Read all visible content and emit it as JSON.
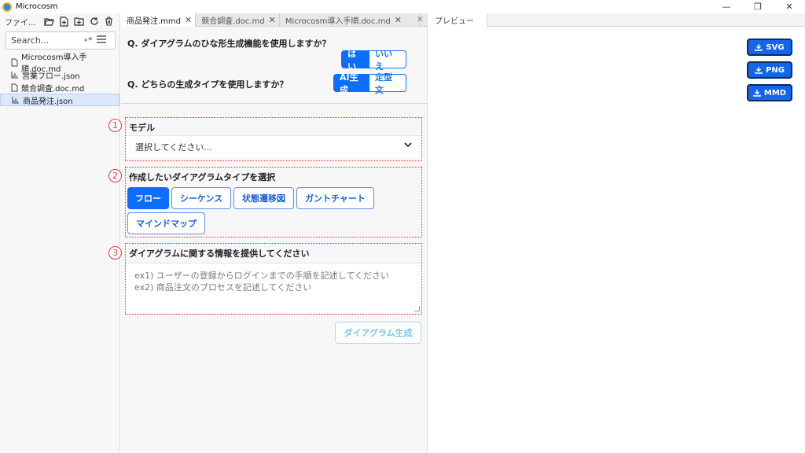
{
  "app": {
    "title": "Microcosm"
  },
  "window": {
    "minimize": "—",
    "restore": "❐",
    "close": "✕"
  },
  "sidebar": {
    "title": "ファイ...",
    "search_placeholder": "Search...",
    "regex_label": "∘*",
    "files": [
      {
        "name": "Microcosm導入手順.doc.md",
        "icon": "document-icon"
      },
      {
        "name": "営業フロー.json",
        "icon": "chart-icon"
      },
      {
        "name": "競合調査.doc.md",
        "icon": "document-icon"
      },
      {
        "name": "商品発注.json",
        "icon": "chart-icon",
        "selected": true
      }
    ]
  },
  "editor": {
    "tabs": [
      {
        "label": "商品発注.mmd",
        "active": true
      },
      {
        "label": "競合調査.doc.md",
        "active": false
      },
      {
        "label": "Microcosm導入手順.doc.md",
        "active": false
      }
    ],
    "q1": {
      "text": "Q. ダイアグラムのひな形生成機能を使用しますか？",
      "yes": "はい",
      "no": "いいえ"
    },
    "q2": {
      "text": "Q. どちらの生成タイプを使用しますか？",
      "ai": "AI生成",
      "fixed": "定型文"
    },
    "step1": {
      "num": "1",
      "label": "モデル",
      "select_value": "選択してください..."
    },
    "step2": {
      "num": "2",
      "label": "作成したいダイアグラムタイプを選択",
      "types": [
        "フロー",
        "シーケンス",
        "状態遷移図",
        "ガントチャート",
        "マインドマップ"
      ]
    },
    "step3": {
      "num": "3",
      "label": "ダイアグラムに関する情報を提供してください",
      "placeholder_line1": "ex1) ユーザーの登録からログインまでの手順を記述してください",
      "placeholder_line2": "ex2) 商品注文のプロセスを記述してください"
    },
    "generate_label": "ダイアグラム生成"
  },
  "preview": {
    "tab": "プレビュー",
    "downloads": [
      "SVG",
      "PNG",
      "MMD"
    ]
  },
  "colors": {
    "primary": "#0d6efd",
    "step_border": "#e53935",
    "disabled_text": "#7cc7ea"
  }
}
